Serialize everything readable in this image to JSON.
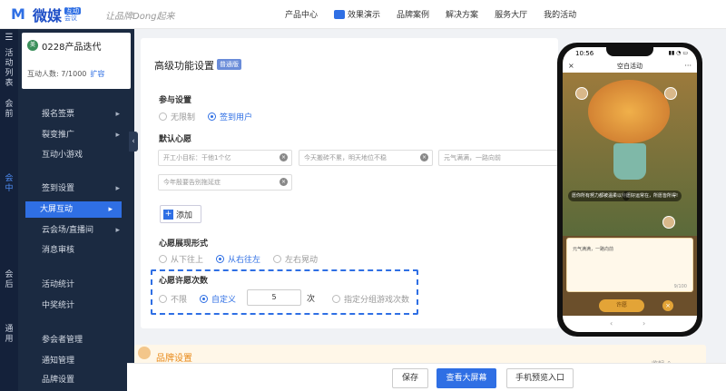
{
  "brand": {
    "logo_name": "微媒",
    "logo_tag_top": "互动",
    "logo_tag_bottom": "会议",
    "slogan": "让品牌Dong起来",
    "accent": "#2f6fe4"
  },
  "topnav": {
    "items": [
      "产品中心",
      "效果演示",
      "品牌案例",
      "解决方案",
      "服务大厅",
      "我的活动"
    ]
  },
  "sidebar": {
    "strip": {
      "activity_list": "活动列表",
      "before": "会前",
      "during": "会中",
      "after": "会后",
      "general": "通用"
    },
    "activity": {
      "avatar_text": "美",
      "title": "0228产品迭代",
      "count_label": "互动人数: 7/1000",
      "expand": "扩容"
    },
    "items": [
      {
        "label": "报名签票",
        "arrow": "▸"
      },
      {
        "label": "裂变推广",
        "arrow": "▸"
      },
      {
        "label": "互动小游戏",
        "arrow": ""
      },
      {
        "label": "签到设置",
        "arrow": "▸"
      },
      {
        "label": "大屏互动",
        "arrow": "▸"
      },
      {
        "label": "云会场/直播间",
        "arrow": "▸"
      },
      {
        "label": "消息审核",
        "arrow": ""
      },
      {
        "label": "活动统计",
        "arrow": ""
      },
      {
        "label": "中奖统计",
        "arrow": ""
      },
      {
        "label": "参会者管理",
        "arrow": ""
      },
      {
        "label": "通知管理",
        "arrow": ""
      },
      {
        "label": "品牌设置",
        "arrow": ""
      }
    ],
    "collapse": "‹"
  },
  "main": {
    "title": "高级功能设置",
    "badge": "普通版",
    "participation": {
      "label": "参与设置",
      "options": [
        "无限制",
        "签到用户"
      ],
      "selected": "签到用户"
    },
    "default_wishes": {
      "label": "默认心愿",
      "values": [
        "开工小目标：干他1个亿",
        "今天搬砖不累，明天地位不稳",
        "元气满满，一路向前",
        "今年殷要告别拖延症"
      ],
      "clear_icon": "×"
    },
    "add_button": "添加",
    "display_form": {
      "label": "心愿展现形式",
      "options": [
        "从下往上",
        "从右往左",
        "左右晃动"
      ],
      "selected": "从右往左"
    },
    "wish_count": {
      "label": "心愿许愿次数",
      "options": [
        "不限",
        "自定义",
        "指定分组游戏次数"
      ],
      "selected": "自定义",
      "value": "5",
      "unit": "次"
    },
    "lower_section_title": "品牌设置",
    "lower_section_right": "收起 ⌃"
  },
  "bottombar": {
    "save": "保存",
    "view_screen": "查看大屏幕",
    "phone_preview": "手机预览入口"
  },
  "phone": {
    "time": "10:56",
    "status_icons": "▮▮ ◔ ▭",
    "header_title": "空白活动",
    "header_close": "×",
    "header_more": "···",
    "bubble_1": "愿你所有努力都被温柔以待",
    "bubble_2": "愿好运常在，所愿皆所得!",
    "card_text": "元气满满，一路向前",
    "card_count": "9/100",
    "action_button": "许愿",
    "cancel_icon": "×",
    "nav_back": "‹",
    "nav_forward": "›"
  }
}
